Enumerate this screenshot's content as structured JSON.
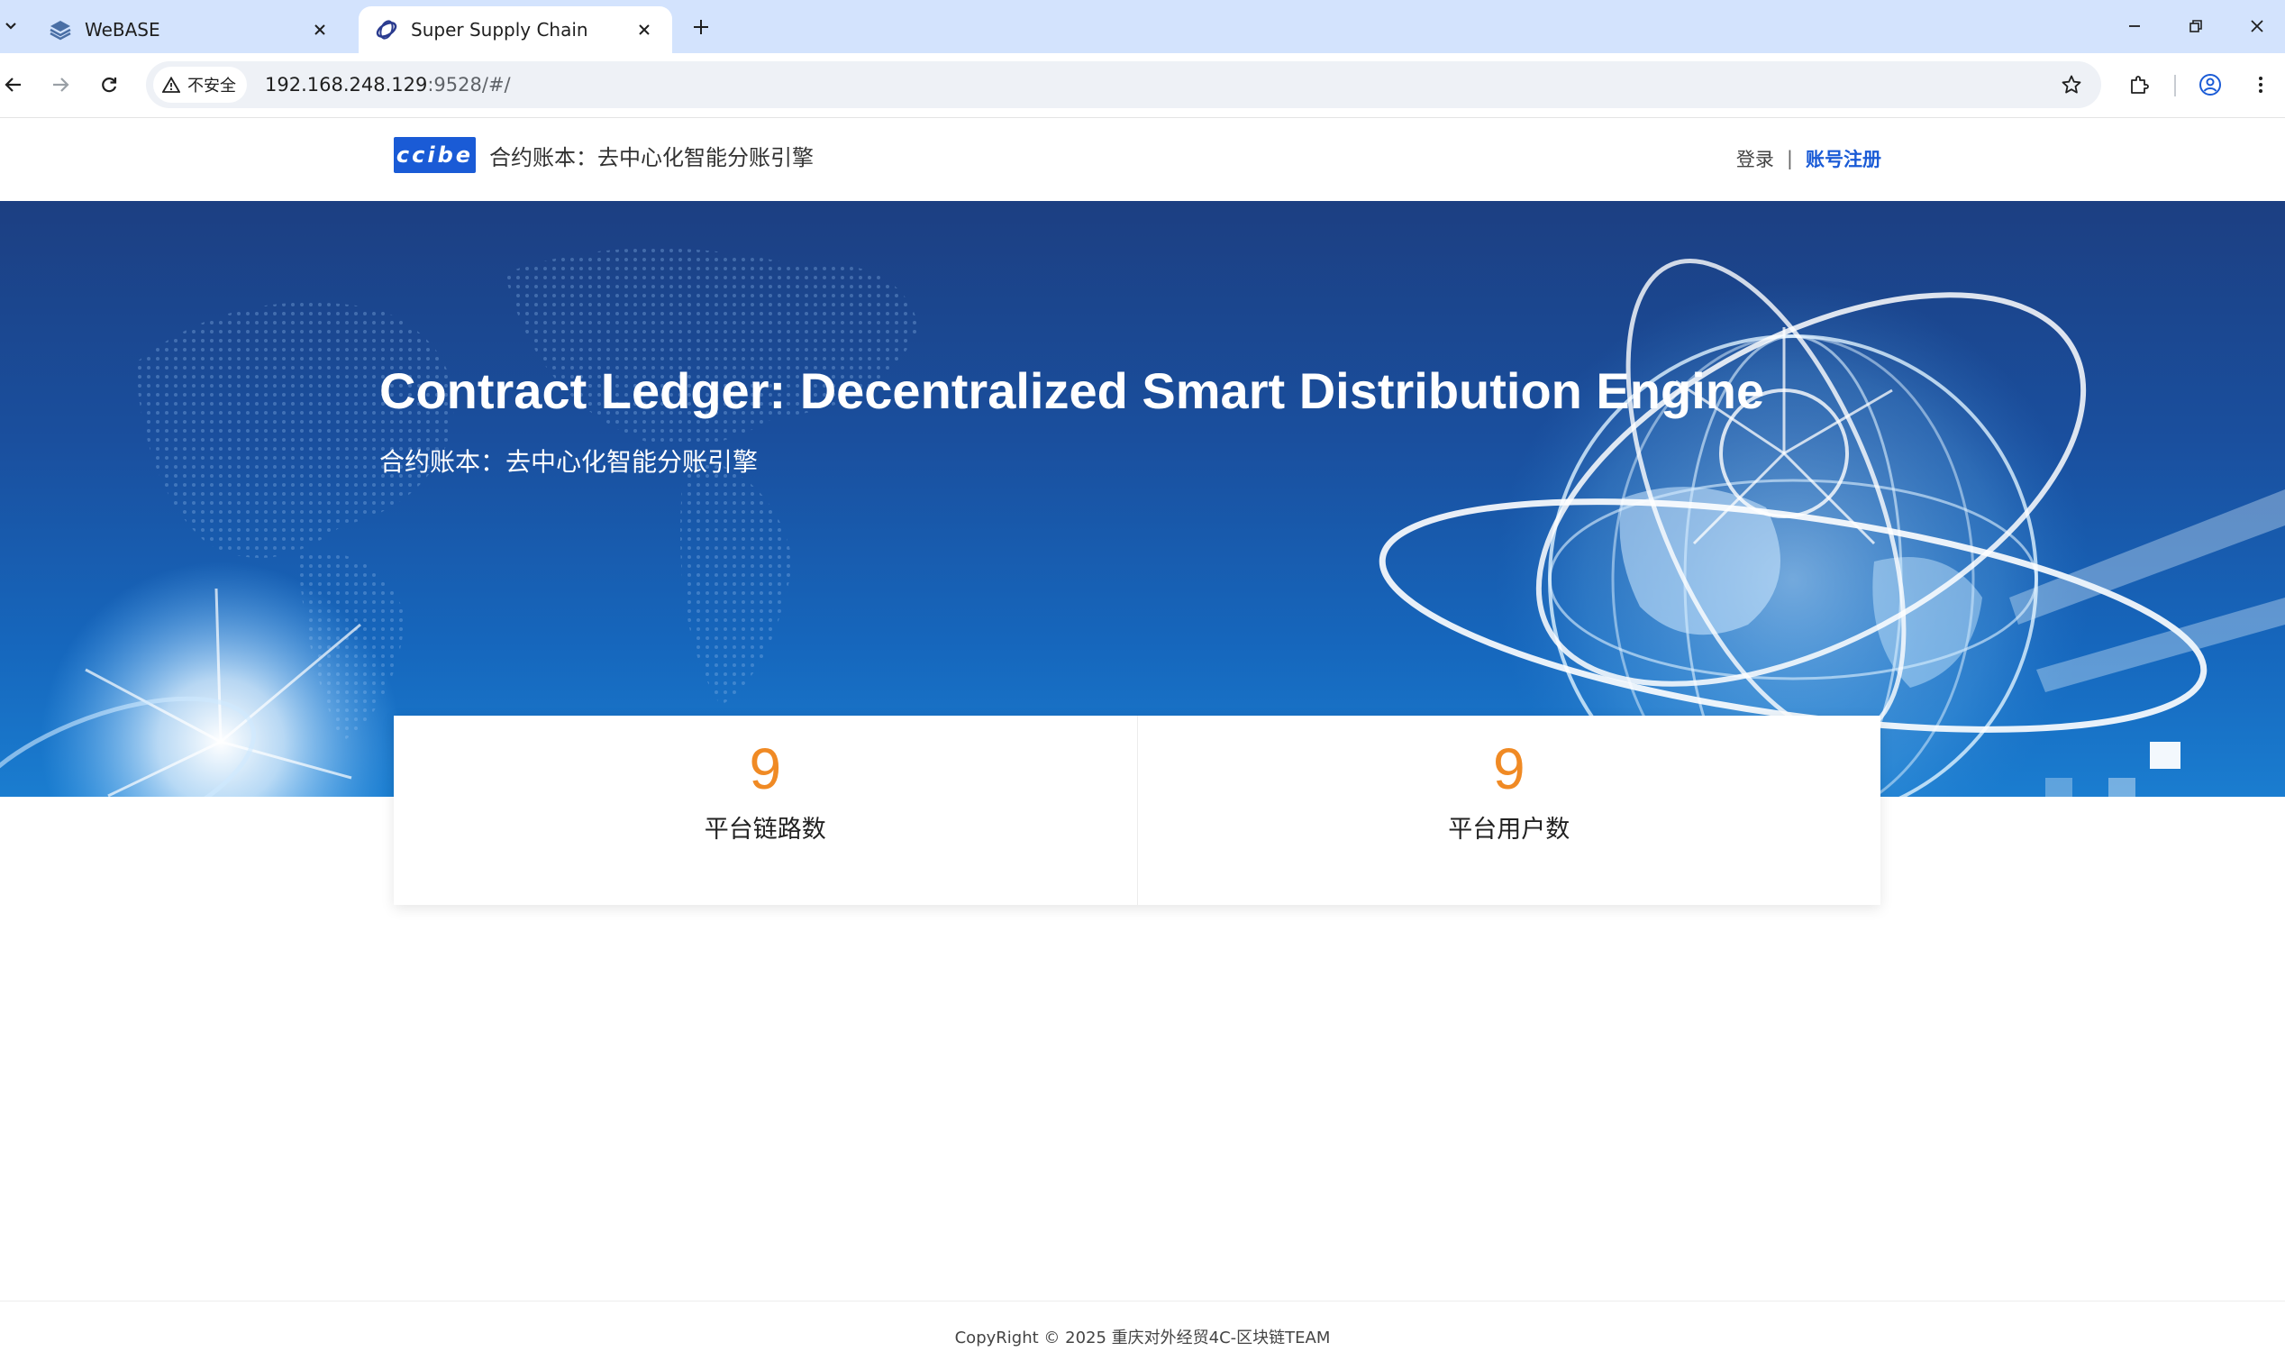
{
  "browser": {
    "tabs": [
      {
        "title": "WeBASE",
        "icon": "layers-icon",
        "active": false
      },
      {
        "title": "Super Supply Chain",
        "icon": "swirl-logo-icon",
        "active": true
      }
    ],
    "security_label": "不安全",
    "url_host": "192.168.248.129",
    "url_path": ":9528/#/"
  },
  "header": {
    "logo_text": "ccibe",
    "site_title": "合约账本：去中心化智能分账引擎",
    "login_label": "登录",
    "separator": "|",
    "register_label": "账号注册"
  },
  "hero": {
    "title": "Contract Ledger: Decentralized Smart Distribution Engine",
    "subtitle": "合约账本：去中心化智能分账引擎"
  },
  "stats": [
    {
      "value": "9",
      "label": "平台链路数"
    },
    {
      "value": "9",
      "label": "平台用户数"
    }
  ],
  "footer": {
    "copyright": "CopyRight © 2025 重庆对外经贸4C-区块链TEAM"
  },
  "colors": {
    "accent": "#1a5bd6",
    "stat_number": "#f08a24",
    "hero_bg": "#1a4f9e"
  }
}
